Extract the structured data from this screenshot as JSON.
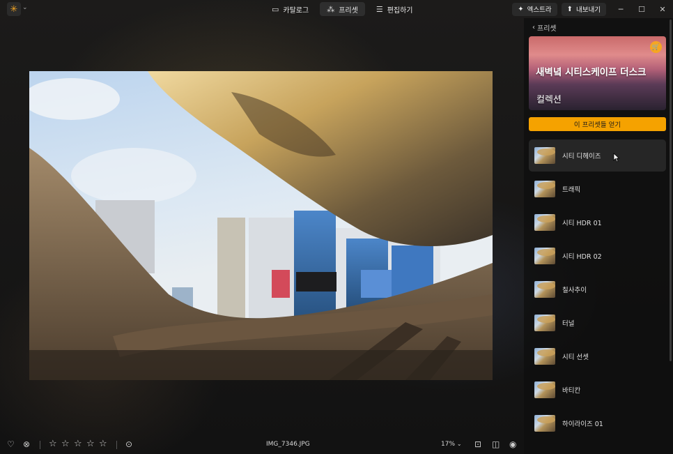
{
  "app": {
    "logo_icon": "sun-logo-icon",
    "accent": "#f5a623"
  },
  "modes": [
    {
      "label": "카탈로그",
      "icon": "folder-icon",
      "active": false
    },
    {
      "label": "프리셋",
      "icon": "sparkle-wand-icon",
      "active": true
    },
    {
      "label": "편집하기",
      "icon": "sliders-icon",
      "active": false
    }
  ],
  "toolbar": {
    "extra_label": "엑스트라",
    "export_label": "내보내기"
  },
  "panel": {
    "back_label": "프리셋",
    "collection_title": "새벽녘 시티스케이프 더스크",
    "collection_subtitle": "컬렉션",
    "get_button_label": "이 프리셋들 얻기",
    "presets": [
      {
        "label": "시티 디헤이즈"
      },
      {
        "label": "트래픽"
      },
      {
        "label": "시티 HDR 01"
      },
      {
        "label": "시티 HDR 02"
      },
      {
        "label": "칠사추이"
      },
      {
        "label": "터널"
      },
      {
        "label": "시티 선셋"
      },
      {
        "label": "바티칸"
      },
      {
        "label": "하이라이즈 01"
      }
    ]
  },
  "bottombar": {
    "filename": "IMG_7346.JPG",
    "zoom": "17%",
    "rating": 0,
    "rating_max": 5
  }
}
